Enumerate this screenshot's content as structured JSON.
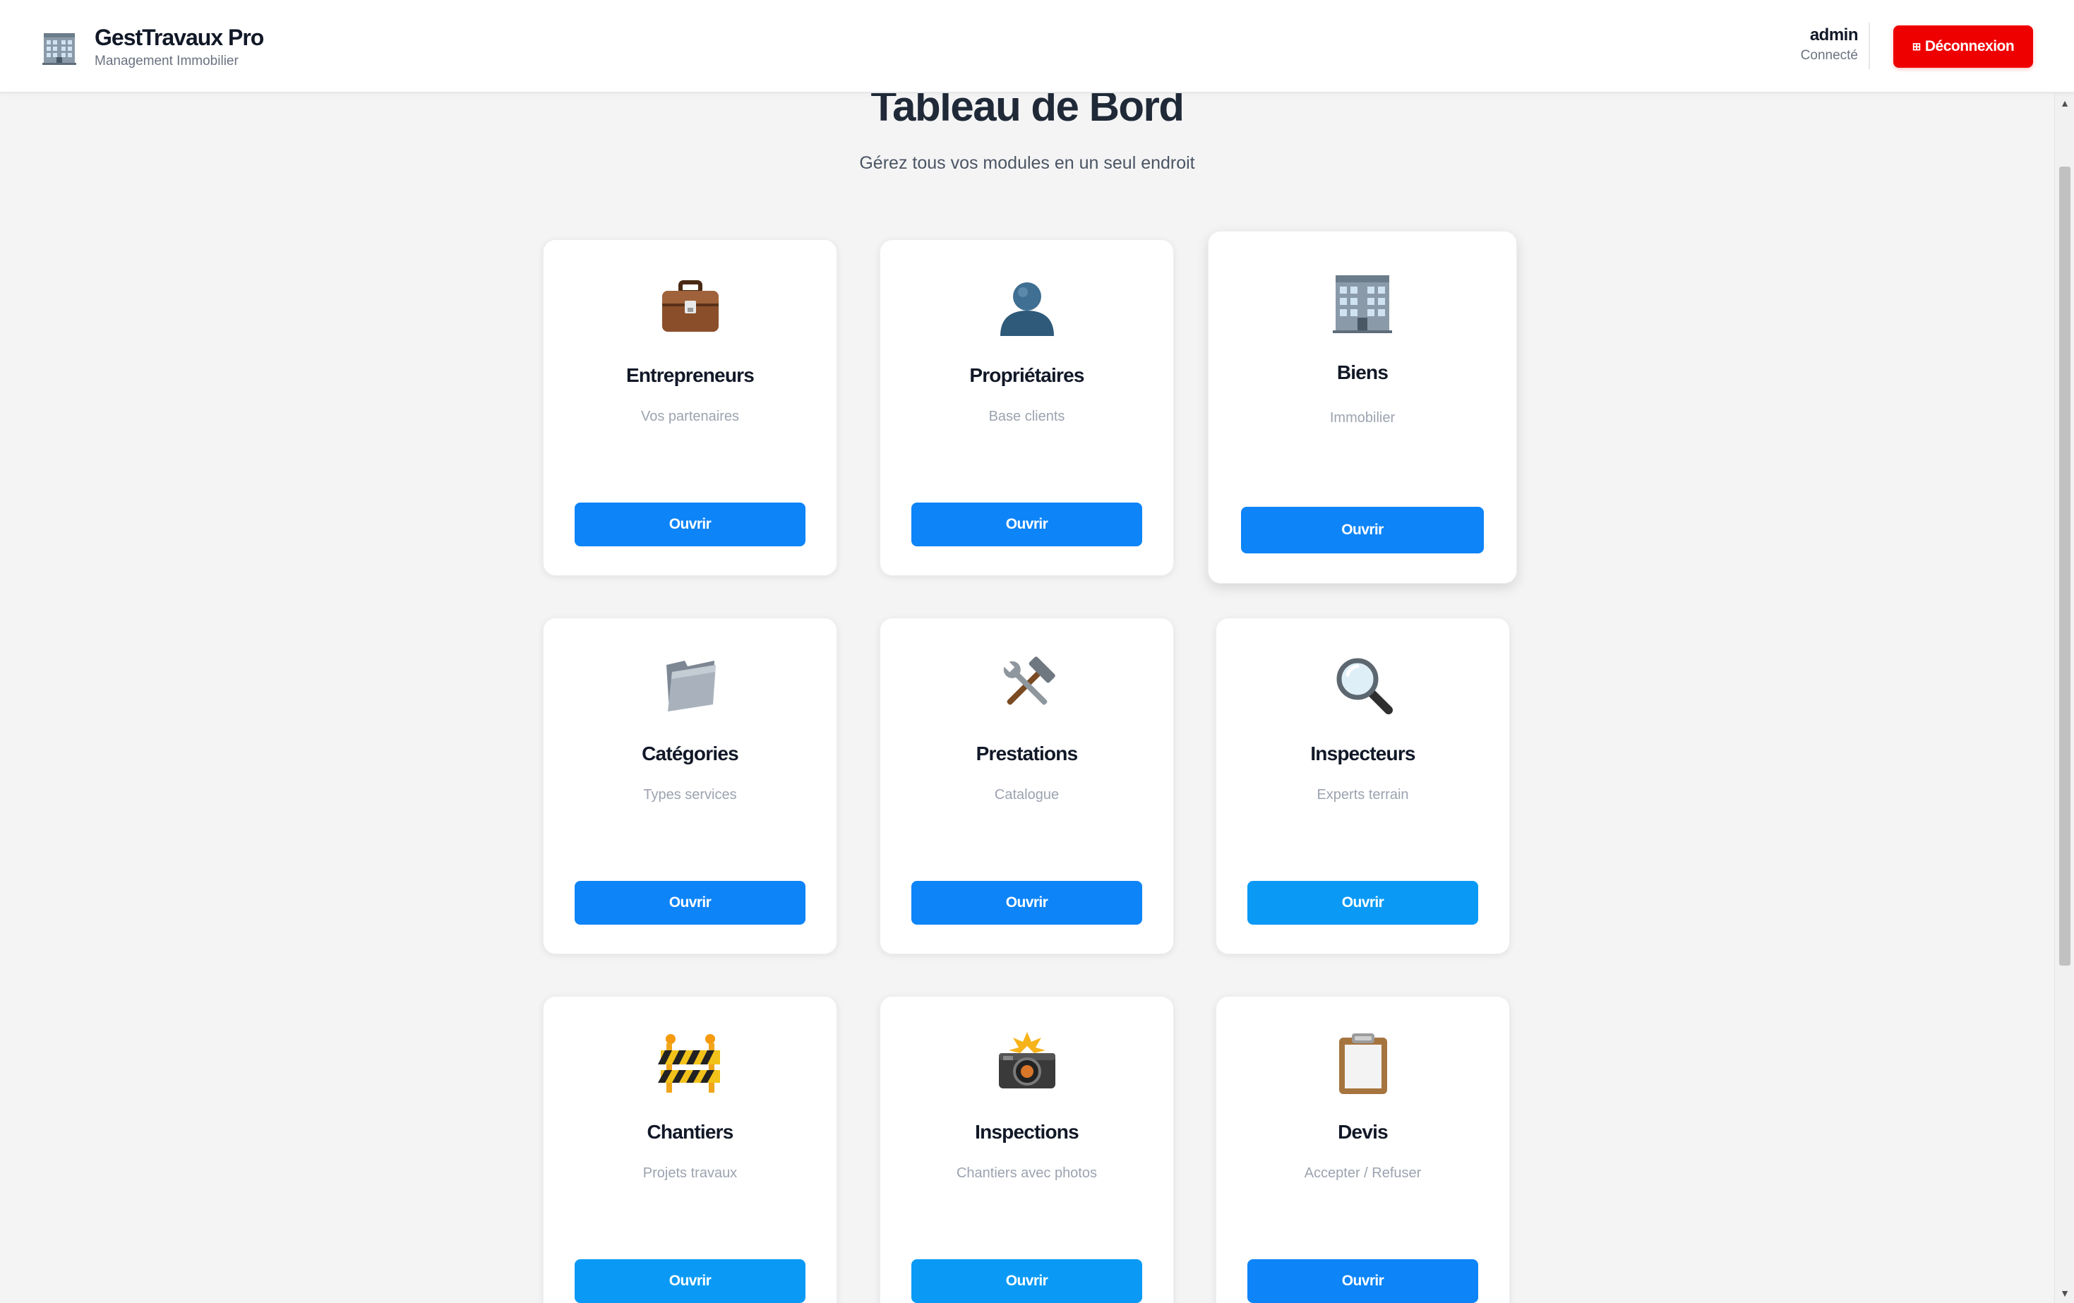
{
  "header": {
    "app_title": "GestTravaux Pro",
    "app_subtitle": "Management Immobilier",
    "logo_icon": "office-building-icon",
    "user": {
      "name": "admin",
      "status": "Connecté"
    },
    "logout": {
      "icon": "⊞",
      "label": "Déconnexion",
      "color": "#ef0000"
    }
  },
  "main": {
    "title": "Tableau de Bord",
    "subtitle": "Gérez tous vos modules en un seul endroit"
  },
  "cards": [
    {
      "id": "entrepreneurs",
      "icon": "briefcase-icon",
      "title": "Entrepreneurs",
      "subtitle": "Vos partenaires",
      "button": "Ouvrir"
    },
    {
      "id": "proprietaires",
      "icon": "person-silhouette-icon",
      "title": "Propriétaires",
      "subtitle": "Base clients",
      "button": "Ouvrir"
    },
    {
      "id": "biens",
      "icon": "office-building-icon",
      "title": "Biens",
      "subtitle": "Immobilier",
      "button": "Ouvrir"
    },
    {
      "id": "categories",
      "icon": "folder-icon",
      "title": "Catégories",
      "subtitle": "Types services",
      "button": "Ouvrir"
    },
    {
      "id": "prestations",
      "icon": "hammer-wrench-icon",
      "title": "Prestations",
      "subtitle": "Catalogue",
      "button": "Ouvrir"
    },
    {
      "id": "inspecteurs",
      "icon": "magnifying-glass-icon",
      "title": "Inspecteurs",
      "subtitle": "Experts terrain",
      "button": "Ouvrir"
    },
    {
      "id": "chantiers",
      "icon": "construction-barrier-icon",
      "title": "Chantiers",
      "subtitle": "Projets travaux",
      "button": "Ouvrir"
    },
    {
      "id": "inspections",
      "icon": "camera-flash-icon",
      "title": "Inspections",
      "subtitle": "Chantiers avec photos",
      "button": "Ouvrir"
    },
    {
      "id": "devis",
      "icon": "clipboard-icon",
      "title": "Devis",
      "subtitle": "Accepter / Refuser",
      "button": "Ouvrir"
    }
  ],
  "colors": {
    "primary_button": "#0d84f7",
    "light_button": "#0a9af5",
    "danger_button": "#ef0000",
    "background": "#f4f4f5"
  }
}
